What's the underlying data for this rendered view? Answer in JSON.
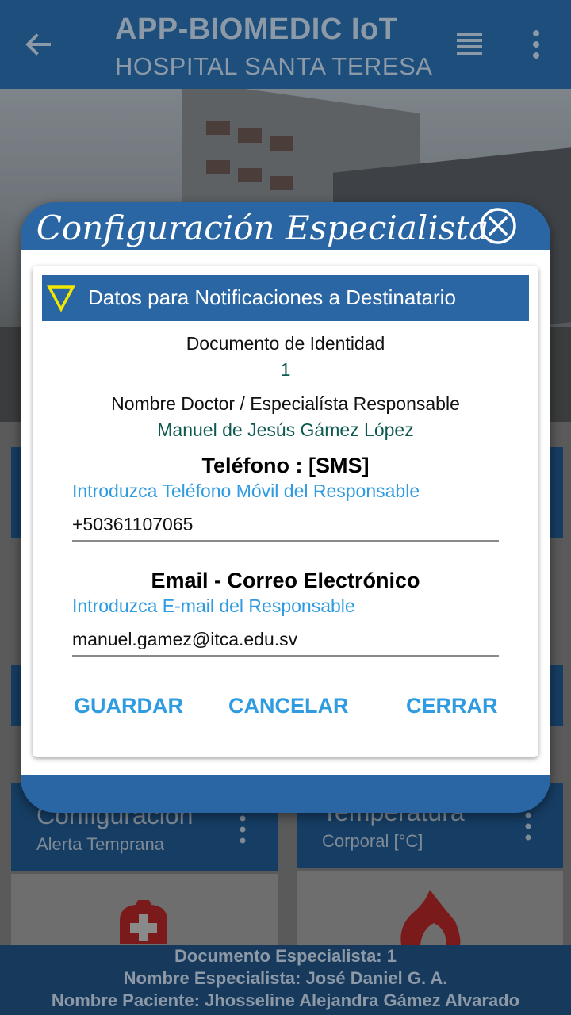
{
  "appbar": {
    "title": "APP-BIOMEDIC IoT",
    "subtitle": "HOSPITAL SANTA TERESA",
    "icons": [
      "arrow-back-icon",
      "list-icon",
      "more-vert-icon"
    ]
  },
  "cards": {
    "left": {
      "title": "Configuración",
      "subtitle": "Alerta Temprana"
    },
    "right": {
      "title": "Temperatura",
      "subtitle": "Corporal [°C]"
    }
  },
  "footer": {
    "line1": "Documento Especialista: 1",
    "line2": "Nombre Especialista: José Daniel G. A.",
    "line3": "Nombre Paciente: Jhosseline Alejandra Gámez Alvarado"
  },
  "dialog": {
    "title": "Configuración Especialista",
    "section": "Datos para Notificaciones a Destinatario",
    "doc_label": "Documento de Identidad",
    "doc_value": "1",
    "name_label": "Nombre Doctor / Especialísta Responsable",
    "name_value": "Manuel de Jesús Gámez López",
    "phone_heading": "Teléfono : [SMS]",
    "phone_hint": "Introduzca Teléfono Móvil del Responsable",
    "phone_value": "+50361107065",
    "email_heading": "Email - Correo Electrónico",
    "email_hint": "Introduzca E-mail del Responsable",
    "email_value": "manuel.gamez@itca.edu.sv",
    "btn_save": "GUARDAR",
    "btn_cancel": "CANCELAR",
    "btn_close": "CERRAR"
  },
  "colors": {
    "appbar": "#1d4e7c",
    "dialog_header": "#2966a3",
    "accent": "#2f9be0",
    "value_text": "#0e5a50",
    "warning_triangle": "#f3e600"
  }
}
